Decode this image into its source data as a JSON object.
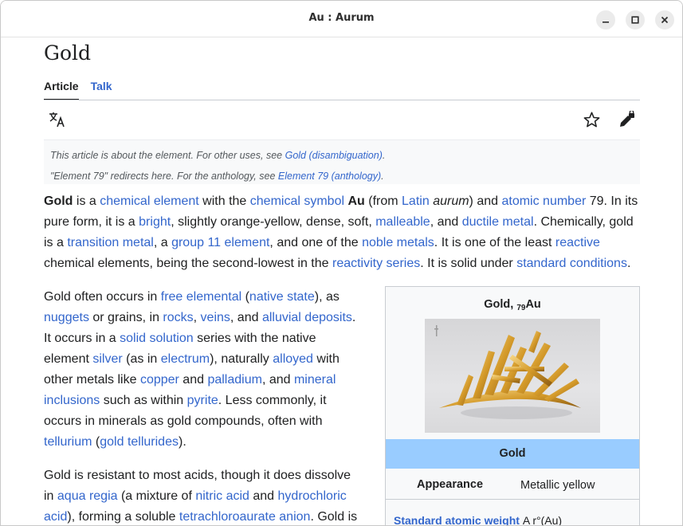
{
  "window": {
    "title": "Au : Aurum"
  },
  "article": {
    "title": "Gold",
    "tabs": [
      {
        "label": "Article"
      },
      {
        "label": "Talk"
      }
    ]
  },
  "hatnotes": [
    {
      "text": "This article is about the element. For other uses, see ",
      "link": "Gold (disambiguation)",
      "end": "."
    },
    {
      "text": "\"Element 79\" redirects here. For the anthology, see ",
      "link": "Element 79 (anthology)",
      "end": "."
    }
  ],
  "paragraphs": {
    "p1": [
      {
        "t": "Gold",
        "b": true
      },
      {
        "t": " is a "
      },
      {
        "t": "chemical element",
        "l": true
      },
      {
        "t": " with the "
      },
      {
        "t": "chemical symbol",
        "l": true
      },
      {
        "t": " "
      },
      {
        "t": "Au",
        "b": true
      },
      {
        "t": " (from "
      },
      {
        "t": "Latin",
        "l": true
      },
      {
        "t": " "
      },
      {
        "t": "aurum",
        "i": true
      },
      {
        "t": ") and "
      },
      {
        "t": "atomic number",
        "l": true
      },
      {
        "t": " 79. In its pure form, it is a "
      },
      {
        "t": "bright",
        "l": true
      },
      {
        "t": ", slightly orange-yellow, dense, soft, "
      },
      {
        "t": "malleable",
        "l": true
      },
      {
        "t": ", and "
      },
      {
        "t": "ductile metal",
        "l": true
      },
      {
        "t": ". Chemically, gold is a "
      },
      {
        "t": "transition metal",
        "l": true
      },
      {
        "t": ", a "
      },
      {
        "t": "group 11 element",
        "l": true
      },
      {
        "t": ", and one of the "
      },
      {
        "t": "noble metals",
        "l": true
      },
      {
        "t": ". It is one of the least "
      },
      {
        "t": "reactive",
        "l": true
      },
      {
        "t": " chemical elements, being the second-lowest in the "
      },
      {
        "t": "reactivity series",
        "l": true
      },
      {
        "t": ". It is solid under "
      },
      {
        "t": "standard conditions",
        "l": true
      },
      {
        "t": "."
      }
    ],
    "p2": [
      {
        "t": "Gold often occurs in "
      },
      {
        "t": "free elemental",
        "l": true
      },
      {
        "t": " ("
      },
      {
        "t": "native state",
        "l": true
      },
      {
        "t": "), as "
      },
      {
        "t": "nuggets",
        "l": true
      },
      {
        "t": " or grains, in "
      },
      {
        "t": "rocks",
        "l": true
      },
      {
        "t": ", "
      },
      {
        "t": "veins",
        "l": true
      },
      {
        "t": ", and "
      },
      {
        "t": "alluvial deposits",
        "l": true
      },
      {
        "t": ". It occurs in a "
      },
      {
        "t": "solid solution",
        "l": true
      },
      {
        "t": " series with the native element "
      },
      {
        "t": "silver",
        "l": true
      },
      {
        "t": " (as in "
      },
      {
        "t": "electrum",
        "l": true
      },
      {
        "t": "), naturally "
      },
      {
        "t": "alloyed",
        "l": true
      },
      {
        "t": " with other metals like "
      },
      {
        "t": "copper",
        "l": true
      },
      {
        "t": " and "
      },
      {
        "t": "palladium",
        "l": true
      },
      {
        "t": ", and "
      },
      {
        "t": "mineral inclusions",
        "l": true
      },
      {
        "t": " such as within "
      },
      {
        "t": "pyrite",
        "l": true
      },
      {
        "t": ". Less commonly, it occurs in minerals as gold compounds, often with "
      },
      {
        "t": "tellurium",
        "l": true
      },
      {
        "t": " ("
      },
      {
        "t": "gold tellurides",
        "l": true
      },
      {
        "t": ")."
      }
    ],
    "p3": [
      {
        "t": "Gold is resistant to most acids, though it does dissolve in "
      },
      {
        "t": "aqua regia",
        "l": true
      },
      {
        "t": " (a mixture of "
      },
      {
        "t": "nitric acid",
        "l": true
      },
      {
        "t": " and "
      },
      {
        "t": "hydrochloric acid",
        "l": true
      },
      {
        "t": "), forming a soluble "
      },
      {
        "t": "tetrachloroaurate anion",
        "l": true
      },
      {
        "t": ". Gold is"
      }
    ]
  },
  "infobox": {
    "title_prefix": "Gold, ",
    "title_sub": "79",
    "title_suffix": "Au",
    "header": "Gold",
    "rows": [
      {
        "label": "Appearance",
        "value": "Metallic yellow"
      }
    ],
    "next_row": {
      "label": "Standard atomic weight",
      "value": "A r°(Au)"
    }
  },
  "icons": {
    "language": "translate-icon",
    "watch": "star-icon",
    "edit": "edit-lock-icon"
  },
  "colors": {
    "link": "#3366cc",
    "infobox_header": "#99ccff",
    "hatnote_bg": "#f8f9fa"
  }
}
